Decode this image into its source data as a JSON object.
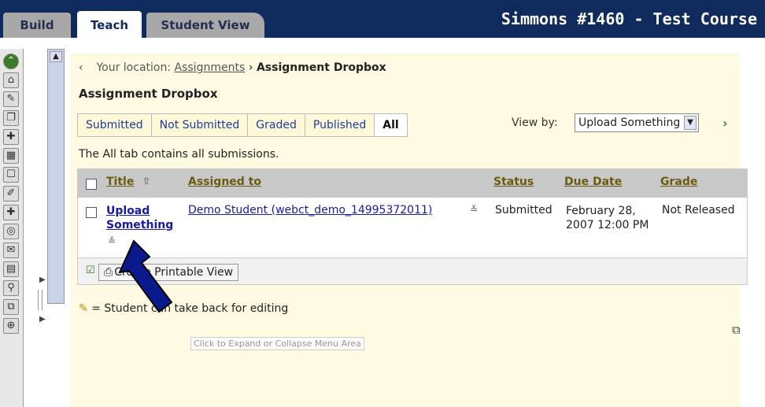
{
  "topbar": {
    "tabs": [
      {
        "label": "Build"
      },
      {
        "label": "Teach"
      },
      {
        "label": "Student View"
      }
    ],
    "course_title": "Simmons #1460 - Test Course"
  },
  "breadcrumb": {
    "prefix": "Your location:",
    "link": "Assignments",
    "separator": "›",
    "current": "Assignment Dropbox"
  },
  "page_title": "Assignment Dropbox",
  "filter_tabs": [
    {
      "label": "Submitted"
    },
    {
      "label": "Not Submitted"
    },
    {
      "label": "Graded"
    },
    {
      "label": "Published"
    },
    {
      "label": "All"
    }
  ],
  "view_by": {
    "label": "View by:",
    "selected": "Upload Something"
  },
  "description": "The All tab contains all submissions.",
  "table": {
    "headers": {
      "title": "Title",
      "assigned_to": "Assigned to",
      "status": "Status",
      "due_date": "Due Date",
      "grade": "Grade"
    },
    "row": {
      "title": "Upload Something",
      "assigned_to": "Demo Student (webct_demo_14995372011)",
      "status": "Submitted",
      "due_date": "February 28, 2007 12:00 PM",
      "grade": "Not Released"
    },
    "footer_button": "Create Printable View"
  },
  "legend_text": "= Student can take back for editing",
  "tooltip": "Click to Expand or Collapse Menu Area",
  "colors": {
    "topbar": "#0f2a5c",
    "content_bg": "#fffbe3",
    "link": "#1a3da0",
    "header_bg": "#c8c8c8",
    "arrow": "#0a1a8c"
  }
}
